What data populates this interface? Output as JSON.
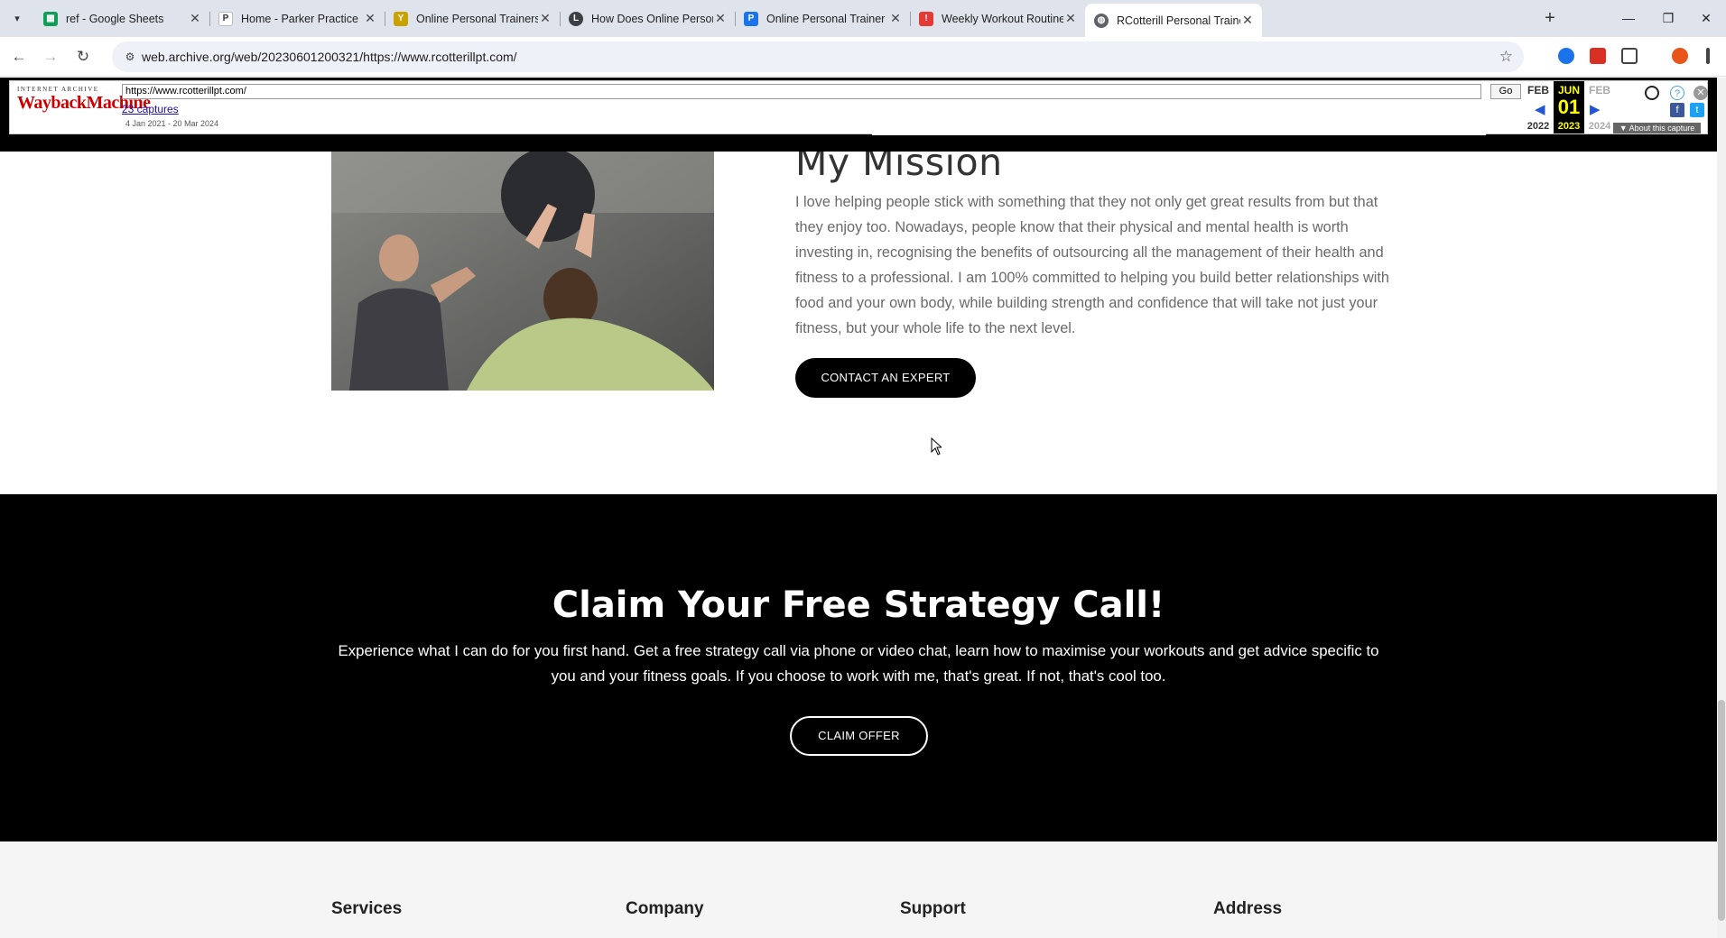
{
  "browser": {
    "tabs": [
      {
        "title": "ref - Google Sheets",
        "favicon_color": "#0f9d58"
      },
      {
        "title": "Home - Parker Practice",
        "favicon_color": "#ffffff"
      },
      {
        "title": "Online Personal Trainers - Fitne",
        "favicon_color": "#c7a200"
      },
      {
        "title": "How Does Online Personal Trai",
        "favicon_color": "#3c4043"
      },
      {
        "title": "Online Personal Trainer | Online",
        "favicon_color": "#1a73e8"
      },
      {
        "title": "Weekly Workout Routine & Per",
        "favicon_color": "#e53935"
      },
      {
        "title": "RCotterill Personal Trainer - Per",
        "favicon_color": "#5f6368"
      }
    ],
    "active_tab_index": 6,
    "url": "web.archive.org/web/20230601200321/https://www.rcotterillpt.com/"
  },
  "wayback": {
    "logo_small": "INTERNET ARCHIVE",
    "logo_big": "WaybackMachine",
    "url_value": "https://www.rcotterillpt.com/",
    "go_label": "Go",
    "captures_label": "23 captures",
    "date_range": "4 Jan 2021 - 20 Mar 2024",
    "prev": {
      "month": "FEB",
      "year": "2022"
    },
    "current": {
      "month": "JUN",
      "day": "01",
      "year": "2023"
    },
    "next": {
      "month": "FEB",
      "year": "2024"
    },
    "about_label": "▼ About this capture"
  },
  "page": {
    "mission": {
      "title": "My Mission",
      "body": "I love helping people stick with something that they not only get great results from but that they enjoy too. Nowadays, people know that their physical and mental health is worth investing in, recognising the benefits of outsourcing all the management of their health and fitness to a professional. I am 100% committed to helping you build better relationships with food and your own body, while building strength and confidence that will take not just your fitness, but your whole life to the next level.",
      "button": "CONTACT AN EXPERT"
    },
    "strategy": {
      "title": "Claim Your Free Strategy Call!",
      "body": "Experience what I can do for you first hand. Get a free strategy call via phone or video chat, learn how to maximise your workouts and get advice specific to you and your fitness goals. If you choose to work with me, that's great. If not, that's cool too.",
      "button": "CLAIM OFFER"
    },
    "footer": {
      "columns": [
        "Services",
        "Company",
        "Support",
        "Address"
      ]
    }
  }
}
